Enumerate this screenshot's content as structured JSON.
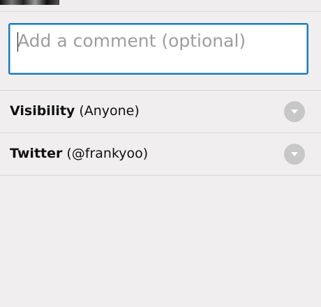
{
  "comment": {
    "placeholder": "Add a comment (optional)"
  },
  "settings": {
    "visibility": {
      "label": "Visibility",
      "value": "(Anyone)"
    },
    "twitter": {
      "label": "Twitter",
      "value": "(@frankyoo)"
    }
  },
  "icons": {
    "dropdown": "chevron-down-icon"
  }
}
